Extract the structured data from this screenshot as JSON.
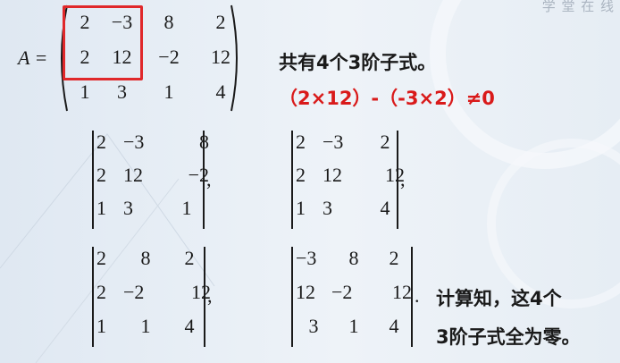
{
  "watermark": "学 堂 在 线",
  "matrix_A": {
    "label": "A =",
    "rows": [
      [
        "2",
        "−3",
        "8",
        "2"
      ],
      [
        "2",
        "12",
        "−2",
        "12"
      ],
      [
        "1",
        "3",
        "1",
        "4"
      ]
    ]
  },
  "note_count": "共有4个3阶子式。",
  "note_condition": "（2×12）-（-3×2）≠0",
  "determinants": [
    {
      "rows": [
        [
          "2",
          "−3",
          "8"
        ],
        [
          "2",
          "12",
          "−2"
        ],
        [
          "1",
          "3",
          "1"
        ]
      ],
      "punct": ","
    },
    {
      "rows": [
        [
          "2",
          "−3",
          "2"
        ],
        [
          "2",
          "12",
          "12"
        ],
        [
          "1",
          "3",
          "4"
        ]
      ],
      "punct": ","
    },
    {
      "rows": [
        [
          "2",
          "8",
          "2"
        ],
        [
          "2",
          "−2",
          "12"
        ],
        [
          "1",
          "1",
          "4"
        ]
      ],
      "punct": ","
    },
    {
      "rows": [
        [
          "−3",
          "8",
          "2"
        ],
        [
          "12",
          "−2",
          "12"
        ],
        [
          "3",
          "1",
          "4"
        ]
      ],
      "punct": "."
    }
  ],
  "conclusion": [
    "计算知，这4个",
    "3阶子式全为零。"
  ],
  "colors": {
    "highlight": "#e0282a",
    "red_text": "#d91a1a",
    "background": "#e6edf4"
  }
}
